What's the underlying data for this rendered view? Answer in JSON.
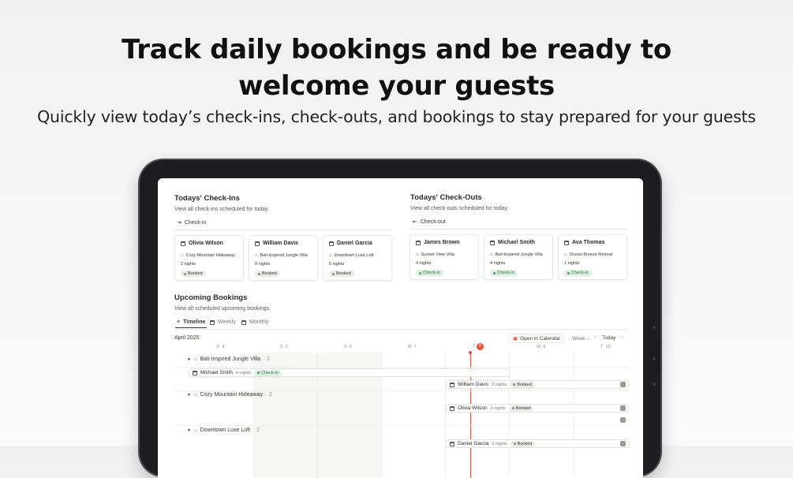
{
  "hero": {
    "title_line1": "Track daily bookings and be ready to",
    "title_line2": "welcome your guests",
    "subtitle": "Quickly view today’s check-ins, check-outs, and bookings to stay prepared for your guests"
  },
  "checkins": {
    "title": "Todays' Check-Ins",
    "description": "View all check-ins scheduled for today.",
    "view_label": "Check-in",
    "cards": [
      {
        "name": "Olivia Wilson",
        "property": "Cozy Mountain Hideaway",
        "nights": "2 nights",
        "status": "Booked"
      },
      {
        "name": "William Davis",
        "property": "Bali-Inspired Jungle Villa",
        "nights": "9 nights",
        "status": "Booked"
      },
      {
        "name": "Daniel Garcia",
        "property": "Downtown Luxe Loft",
        "nights": "5 nights",
        "status": "Booked"
      }
    ]
  },
  "checkouts": {
    "title": "Todays' Check-Outs",
    "description": "View all check-outs scheduled for today.",
    "view_label": "Check-out",
    "cards": [
      {
        "name": "James Brown",
        "property": "Sunset View Villa",
        "nights": "4 nights",
        "status": "Check-in"
      },
      {
        "name": "Michael Smith",
        "property": "Bali-Inspired Jungle Villa",
        "nights": "4 nights",
        "status": "Check-in"
      },
      {
        "name": "Ava Thomas",
        "property": "Ocean Breeze Retreat",
        "nights": "1 nights",
        "status": "Check-in"
      }
    ]
  },
  "upcoming": {
    "title": "Upcoming Bookings",
    "description": "View all scheduled upcoming bookings.",
    "tabs": [
      "Timeline",
      "Weekly",
      "Monthly"
    ],
    "month": "April 2025",
    "open_calendar": "Open in Calendar",
    "range": "Week",
    "today": "Today",
    "days": [
      {
        "label": "F",
        "num": "4"
      },
      {
        "label": "S",
        "num": "5"
      },
      {
        "label": "S",
        "num": "6"
      },
      {
        "label": "M",
        "num": "7"
      },
      {
        "label": "T",
        "num": "8"
      },
      {
        "label": "W",
        "num": "9"
      },
      {
        "label": "T",
        "num": "10"
      }
    ],
    "groups": [
      {
        "name": "Bali-Inspired Jungle Villa",
        "count": "2"
      },
      {
        "name": "Cozy Mountain Hideaway",
        "count": "2"
      },
      {
        "name": "Downtown Luxe Loft",
        "count": "2"
      }
    ],
    "bookings": [
      {
        "name": "Michael Smith",
        "nights": "4 nights",
        "status": "Check-in"
      },
      {
        "name": "William Davis",
        "nights": "9 nights",
        "status": "Booked"
      },
      {
        "name": "Olivia Wilson",
        "nights": "2 nights",
        "status": "Booked"
      },
      {
        "name": "Daniel Garcia",
        "nights": "5 nights",
        "status": "Booked"
      }
    ]
  },
  "colors": {
    "today_marker": "#e5533d",
    "checkin_badge": "#dcefe1",
    "booked_badge": "#ebebea"
  }
}
